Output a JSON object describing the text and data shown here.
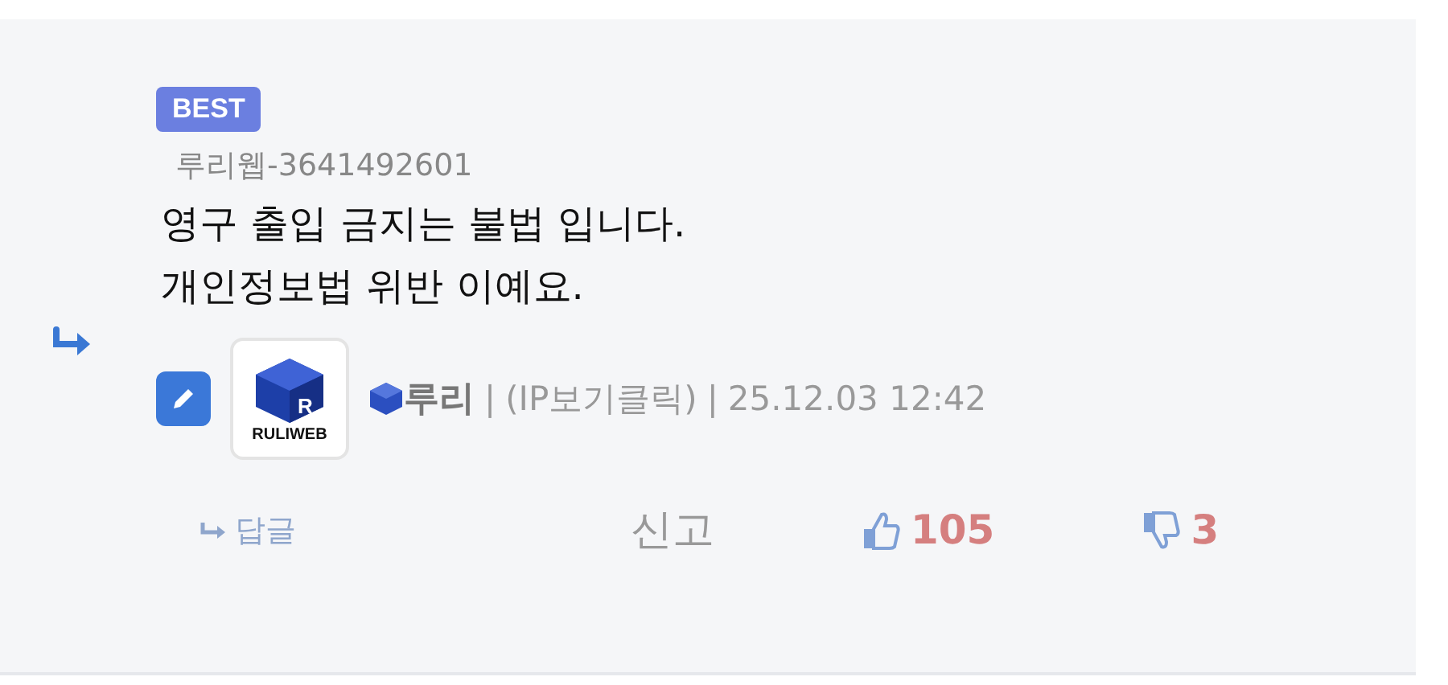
{
  "badge": "BEST",
  "author_id": "루리웹-3641492601",
  "lines": [
    "영구 출입 금지는 불법 입니다.",
    "개인정보법 위반 이예요."
  ],
  "logo": {
    "letter": "R",
    "wordmark": "RULIWEB"
  },
  "nickname": "루리",
  "separator": "|",
  "ip_link": "(IP보기클릭)",
  "timestamp": "25.12.03 12:42",
  "actions": {
    "reply": "답글",
    "report": "신고",
    "likes": "105",
    "dislikes": "3"
  }
}
